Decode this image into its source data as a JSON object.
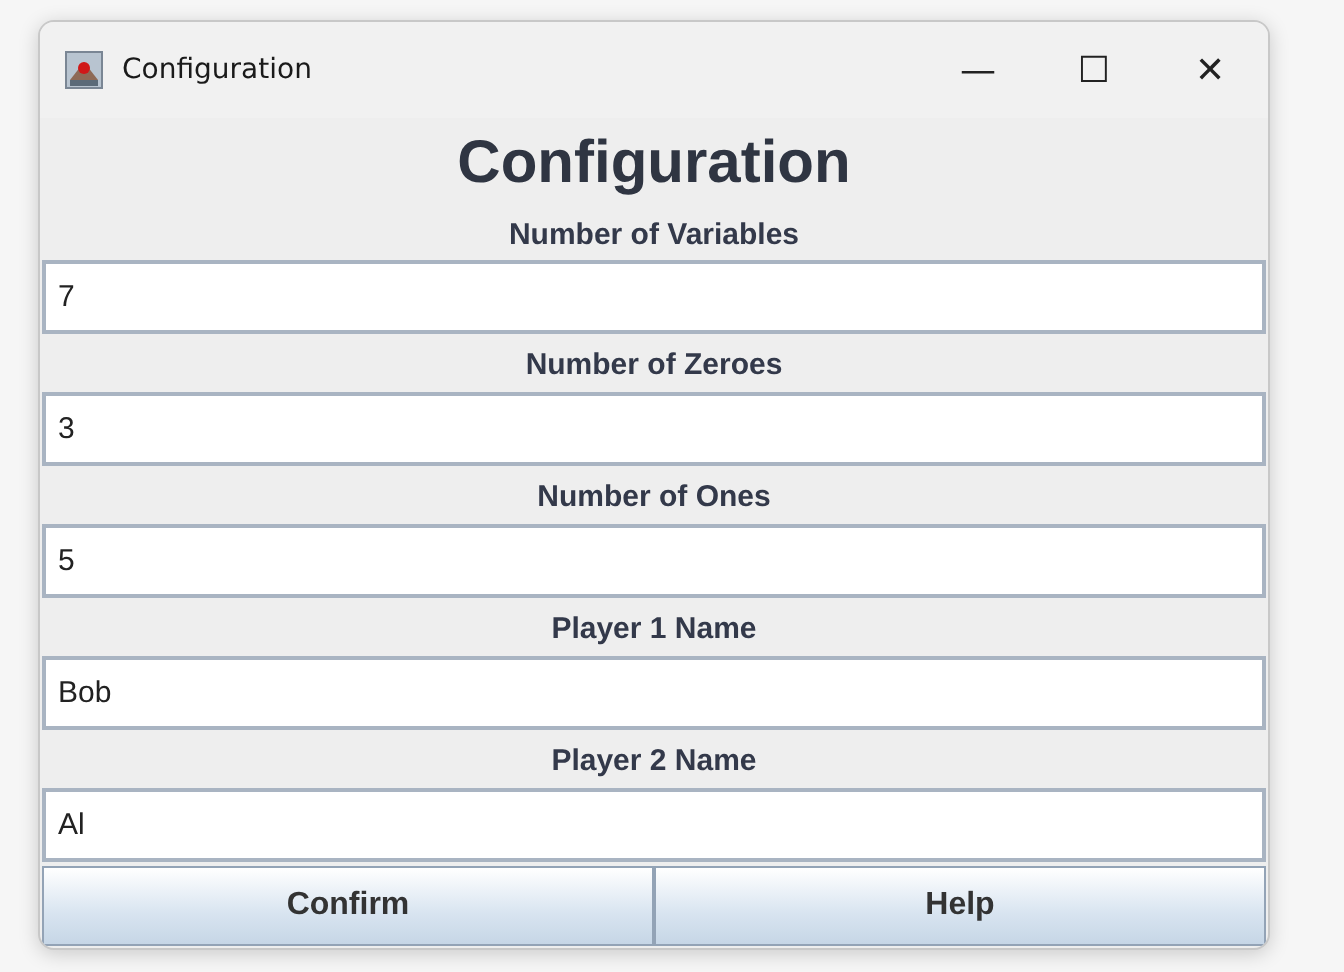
{
  "window": {
    "title": "Configuration",
    "controls": [
      "—",
      "☐",
      "✕"
    ]
  },
  "heading": "Configuration",
  "fields": [
    {
      "label": "Number of Variables",
      "value": "7"
    },
    {
      "label": "Number of Zeroes",
      "value": "3"
    },
    {
      "label": "Number of Ones",
      "value": "5"
    },
    {
      "label": "Player 1 Name",
      "value": "Bob"
    },
    {
      "label": "Player 2 Name",
      "value": "Al"
    }
  ],
  "buttons": [
    "Confirm",
    "Help"
  ]
}
